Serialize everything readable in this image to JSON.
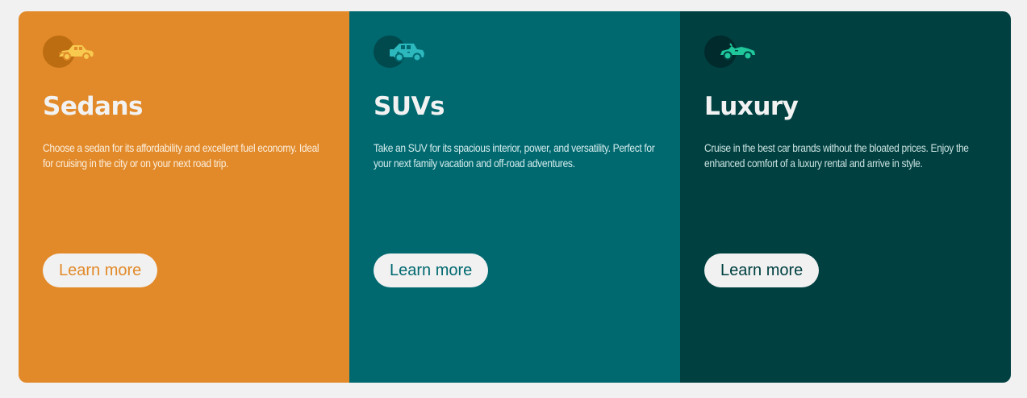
{
  "colors": {
    "page_background": "#f1f1f1",
    "sedans": "#e28a29",
    "suvs": "#006970",
    "luxury": "#004041",
    "sedans_icon": "#f7c94f",
    "suvs_icon": "#2cb8bd",
    "luxury_icon": "#1fc79b"
  },
  "cards": [
    {
      "icon": "sedan-car-icon",
      "title": "Sedans",
      "text": "Choose a sedan for its affordability and excellent fuel economy. Ideal for cruising in the city or on your next road trip.",
      "button_label": "Learn more"
    },
    {
      "icon": "suv-car-icon",
      "title": "SUVs",
      "text": "Take an SUV for its spacious interior, power, and versatility. Perfect for your next family vacation and off-road adventures.",
      "button_label": "Learn more"
    },
    {
      "icon": "luxury-car-icon",
      "title": "Luxury",
      "text": "Cruise in the best car brands without the bloated prices. Enjoy the enhanced comfort of a luxury rental and arrive in style.",
      "button_label": "Learn more"
    }
  ]
}
